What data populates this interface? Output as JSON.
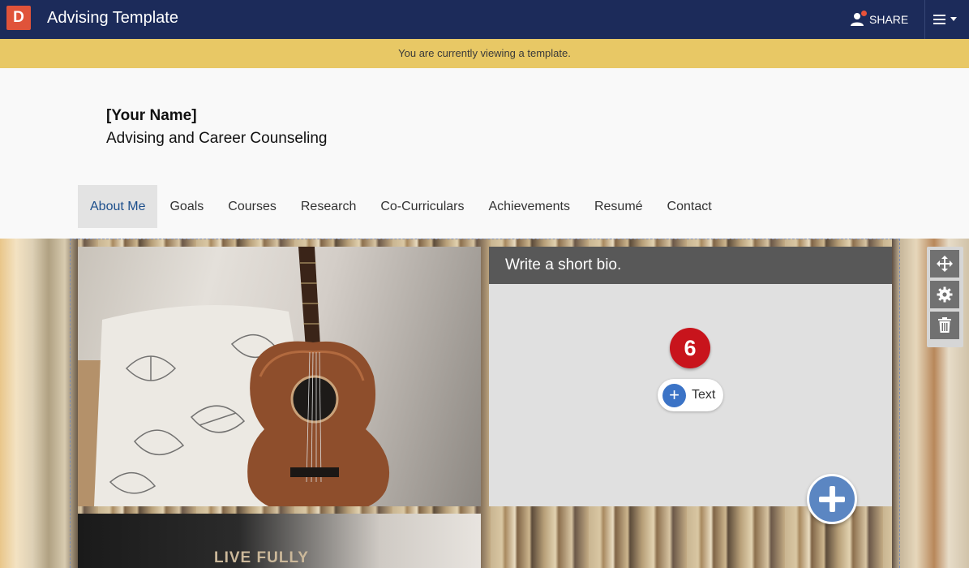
{
  "app": {
    "logo_letter": "D",
    "title": "Advising Template",
    "share_label": "SHARE"
  },
  "banner": {
    "text": "You are currently viewing a template."
  },
  "site": {
    "name": "[Your Name]",
    "subtitle": "Advising and Career Counseling"
  },
  "nav": {
    "items": [
      {
        "label": "About Me",
        "active": true
      },
      {
        "label": "Goals"
      },
      {
        "label": "Courses"
      },
      {
        "label": "Research"
      },
      {
        "label": "Co-Curriculars"
      },
      {
        "label": "Achievements"
      },
      {
        "label": "Resumé"
      },
      {
        "label": "Contact"
      }
    ]
  },
  "bio": {
    "header": "Write a short bio.",
    "step_number": "6",
    "add_text_label": "Text"
  },
  "photo2": {
    "text": "LIVE FULLY"
  },
  "icons": {
    "share": "person-icon",
    "menu": "hamburger-menu-icon",
    "move": "move-arrows-icon",
    "settings": "gear-icon",
    "delete": "trash-icon",
    "add": "plus-icon"
  },
  "colors": {
    "topbar": "#1c2b5a",
    "banner": "#e8c865",
    "logo": "#e0533a",
    "step_badge": "#c8141c",
    "add_button": "#3b73c6",
    "nav_active_text": "#1d4f8c"
  }
}
